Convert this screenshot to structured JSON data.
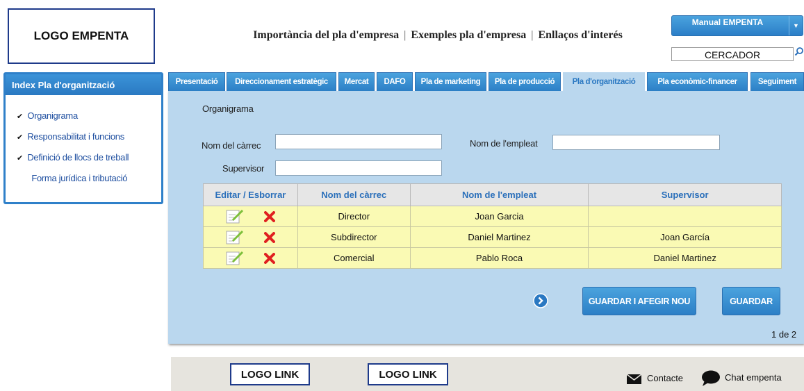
{
  "logo": "LOGO EMPENTA",
  "topnav": [
    "Importància del pla d'empresa",
    "Exemples pla d'empresa",
    "Enllaços d'interés"
  ],
  "manual_button": "Manual EMPENTA",
  "search": {
    "value": "CERCADOR"
  },
  "sidebar": {
    "title": "Index Pla d'organització",
    "items": [
      {
        "label": "Organigrama",
        "checked": true
      },
      {
        "label": "Responsabilitat i funcions",
        "checked": true
      },
      {
        "label": "Definició de llocs de treball",
        "checked": true
      },
      {
        "label": "Forma jurídica i tributació",
        "checked": false
      }
    ]
  },
  "tabs": [
    "Presentació",
    "Direccionament estratègic",
    "Mercat",
    "DAFO",
    "Pla de marketing",
    "Pla de producció",
    "Pla d'organització",
    "Pla econòmic-financer",
    "Seguiment"
  ],
  "active_tab": "Pla d'organització",
  "section_title": "Organigrama",
  "form": {
    "carrec_label": "Nom del càrrec",
    "empleat_label": "Nom de l'empleat",
    "supervisor_label": "Supervisor"
  },
  "table": {
    "headers": [
      "Editar / Esborrar",
      "Nom del càrrec",
      "Nom de l'empleat",
      "Supervisor"
    ],
    "rows": [
      {
        "carrec": "Director",
        "empleat": "Joan Garcia",
        "supervisor": ""
      },
      {
        "carrec": "Subdirector",
        "empleat": "Daniel Martinez",
        "supervisor": "Joan García"
      },
      {
        "carrec": "Comercial",
        "empleat": "Pablo Roca",
        "supervisor": "Daniel Martinez"
      }
    ]
  },
  "buttons": {
    "save_add": "GUARDAR I AFEGIR NOU",
    "save": "GUARDAR"
  },
  "pagination": "1 de 2",
  "footer": {
    "logo_link_1": "LOGO LINK",
    "logo_link_2": "LOGO LINK",
    "contact": "Contacte",
    "chat": "Chat empenta"
  },
  "colors": {
    "accent": "#2c7fc6",
    "panel": "#bad7ee",
    "row": "#fafab4",
    "delete": "#e02020"
  }
}
